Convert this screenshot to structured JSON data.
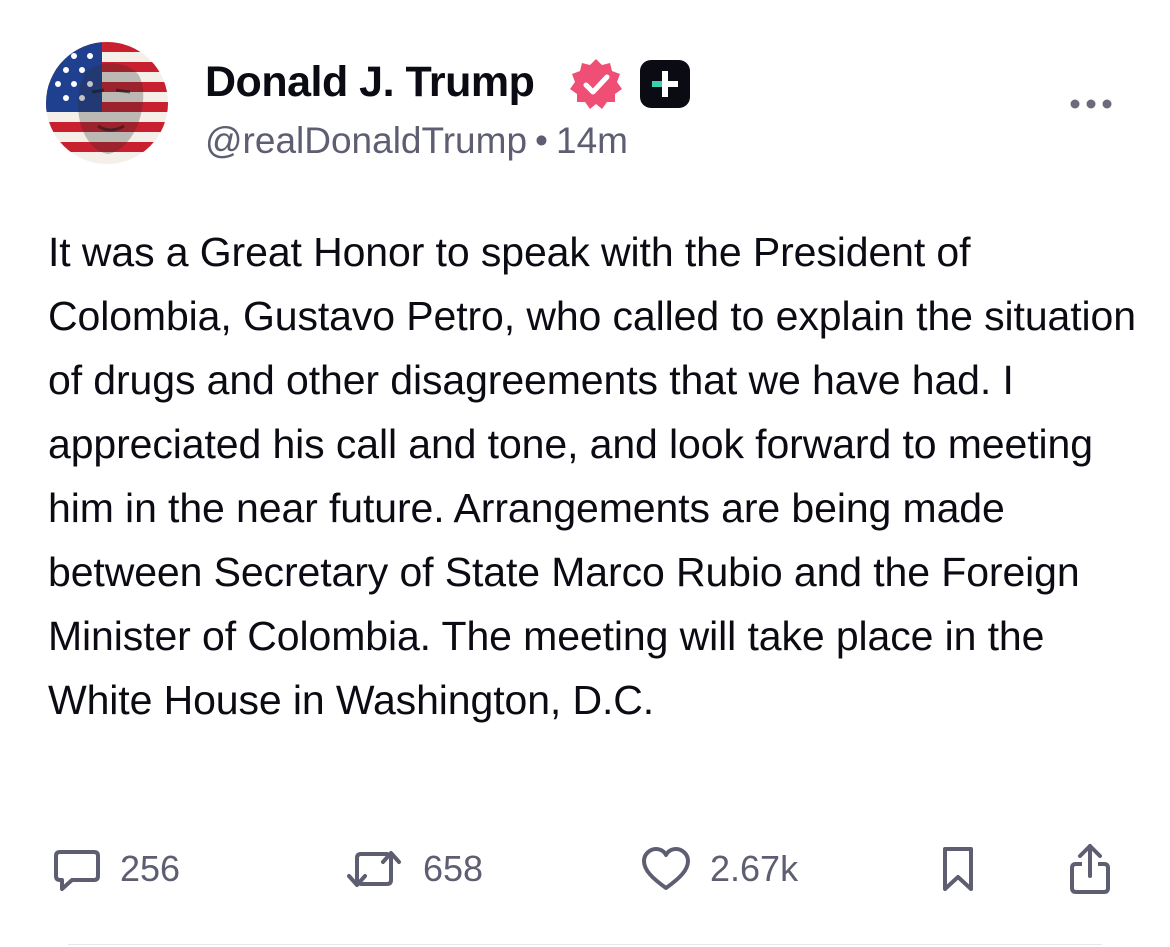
{
  "author": {
    "display_name": "Donald J. Trump",
    "handle": "@realDonaldTrump",
    "separator": "•",
    "time_ago": "14m",
    "verified_icon": "verified-badge-icon",
    "plus_icon": "plus-badge-icon",
    "avatar_icon": "flag-avatar"
  },
  "post": {
    "text": "It was a Great Honor to speak with the President of Colombia, Gustavo Petro, who called to explain the situation of drugs and other disagreements that we have had. I appreciated his call and tone, and look forward to meeting him in the near future. Arrangements are being made between Secretary of State Marco Rubio and the Foreign Minister of Colombia. The meeting will take place in the White House in Washington, D.C."
  },
  "actions": {
    "replies": "256",
    "reposts": "658",
    "likes": "2.67k"
  },
  "colors": {
    "text": "#0b0b14",
    "muted": "#5e5e72",
    "verified": "#ef4f74",
    "badge_bg": "#0b0b14",
    "badge_accent": "#3ad0b1"
  }
}
